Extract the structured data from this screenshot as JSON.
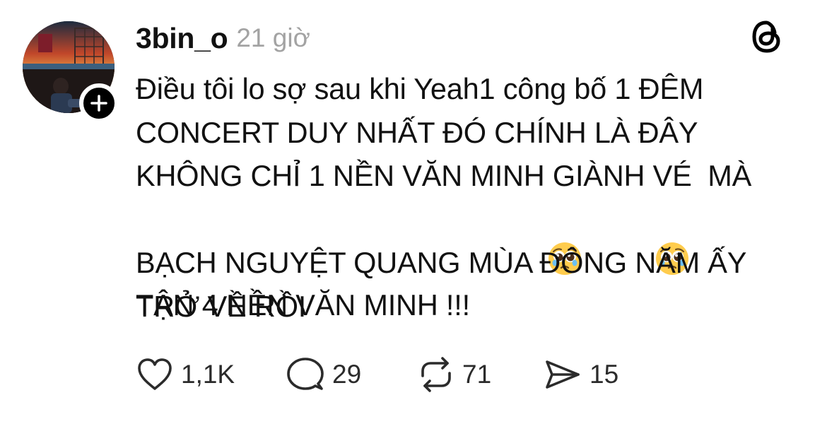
{
  "post": {
    "username": "3bin_o",
    "timestamp": "21 giờ",
    "text_lines": [
      "Điều tôi lo sợ sau khi Yeah1 công bố 1 ĐÊM",
      "CONCERT DUY NHẤT ĐÓ CHÍNH LÀ ĐÂY",
      "KHÔNG CHỈ 1 NỀN VĂN MINH GIÀNH VÉ  MÀ",
      "TẬN 4 NỀN VĂN MINH !!!",
      "BẠCH NGUYỆT QUANG MÙA ĐÔNG NĂM ẤY",
      "TRỞ VỀ RỒI"
    ],
    "emojis": [
      "pleading-face-emoji",
      "pleading-face-emoji"
    ]
  },
  "actions": {
    "like": {
      "icon": "heart-icon",
      "count": "1,1K"
    },
    "reply": {
      "icon": "comment-icon",
      "count": "29"
    },
    "repost": {
      "icon": "repost-icon",
      "count": "71"
    },
    "share": {
      "icon": "send-icon",
      "count": "15"
    }
  },
  "icons": {
    "app_logo": "threads-logo-icon",
    "follow": "plus-icon"
  },
  "colors": {
    "text": "#111111",
    "muted": "#a3a3a3",
    "icon": "#2b2b2b",
    "badge": "#000000"
  }
}
